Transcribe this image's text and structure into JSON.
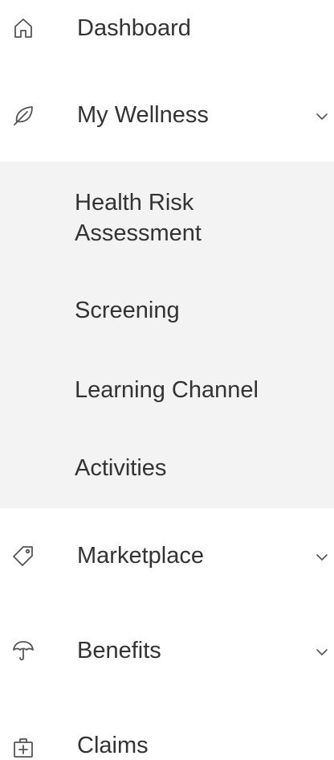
{
  "nav": {
    "items": [
      {
        "label": "Dashboard",
        "icon": "home-icon",
        "expandable": false
      },
      {
        "label": "My Wellness",
        "icon": "leaf-icon",
        "expandable": true,
        "expanded": true
      },
      {
        "label": "Marketplace",
        "icon": "tag-icon",
        "expandable": true
      },
      {
        "label": "Benefits",
        "icon": "umbrella-icon",
        "expandable": true
      },
      {
        "label": "Claims",
        "icon": "medical-case-icon",
        "expandable": false
      }
    ],
    "wellness_submenu": [
      {
        "label": "Health Risk Assessment"
      },
      {
        "label": "Screening"
      },
      {
        "label": "Learning Channel"
      },
      {
        "label": "Activities"
      }
    ]
  },
  "colors": {
    "text": "#333333",
    "icon": "#555555",
    "submenu_bg": "#f3f3f3",
    "background": "#ffffff"
  }
}
